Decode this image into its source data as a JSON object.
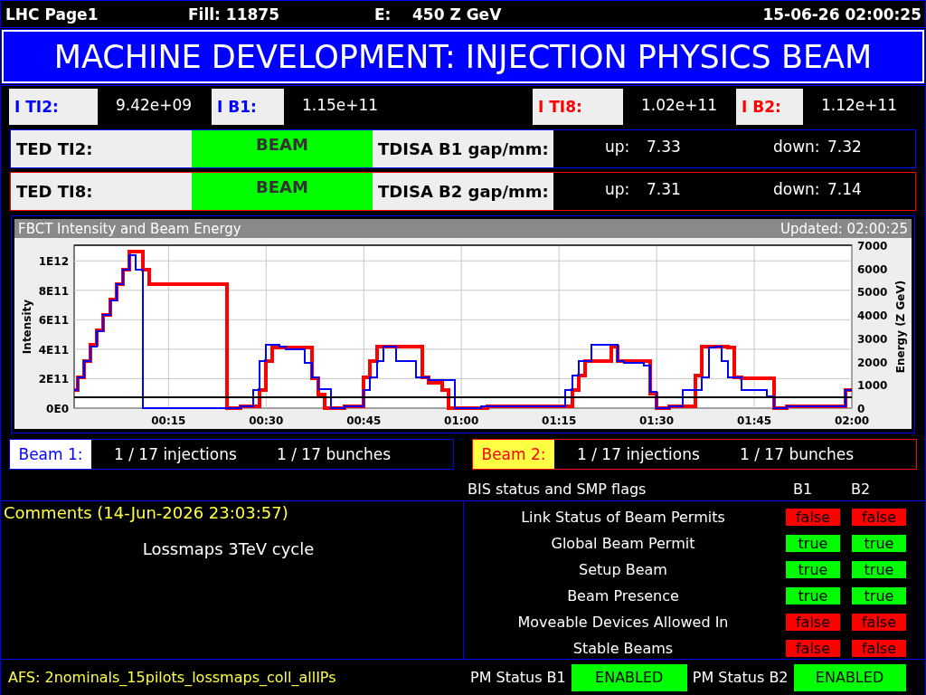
{
  "header": {
    "page": "LHC Page1",
    "fill": "Fill: 11875",
    "energy_label": "E:",
    "energy": "450 Z GeV",
    "timestamp": "15-06-26 02:00:25"
  },
  "mode": "MACHINE DEVELOPMENT: INJECTION PHYSICS BEAM",
  "intensities": [
    {
      "label": "I TI2:",
      "value": "9.42e+09",
      "color": "#0000ff"
    },
    {
      "label": "I B1:",
      "value": "1.15e+11",
      "color": "#0000ff"
    },
    {
      "label": "I TI8:",
      "value": "1.02e+11",
      "color": "#ff0000"
    },
    {
      "label": "I B2:",
      "value": "1.12e+11",
      "color": "#ff0000"
    }
  ],
  "ted_rows": [
    {
      "ted_label": "TED TI2:",
      "ted_state": "BEAM",
      "tdisa_label": "TDISA B1 gap/mm:",
      "up_label": "up:",
      "up": "7.33",
      "down_label": "down:",
      "down": "7.32",
      "color": "#0000ff"
    },
    {
      "ted_label": "TED TI8:",
      "ted_state": "BEAM",
      "tdisa_label": "TDISA B2 gap/mm:",
      "up_label": "up:",
      "up": "7.31",
      "down_label": "down:",
      "down": "7.14",
      "color": "#ff0000"
    }
  ],
  "chart": {
    "title": "FBCT Intensity and Beam Energy",
    "updated": "Updated: 02:00:25",
    "chart_data": {
      "type": "line",
      "ylabel": "Intensity",
      "y2label": "Energy (Z GeV)",
      "grid": true,
      "x": [
        0.5,
        1,
        1,
        2,
        2,
        3,
        3,
        4,
        4,
        5,
        5,
        6,
        6,
        7,
        7,
        8,
        8,
        9,
        9,
        10,
        10,
        11,
        11,
        12,
        12,
        13,
        13,
        14,
        14,
        15,
        15,
        16,
        16,
        17,
        17,
        18,
        18,
        19,
        19,
        20,
        20,
        21,
        21,
        22,
        22,
        23,
        23,
        24,
        24,
        25,
        25,
        26,
        26,
        27,
        27,
        28,
        28,
        29,
        29,
        30,
        30,
        31,
        31,
        32,
        32,
        33,
        33,
        34,
        34,
        35,
        35,
        36,
        36,
        37,
        37,
        38,
        38,
        39,
        39,
        40,
        40,
        41,
        41,
        42,
        42,
        43,
        43,
        44,
        44,
        45,
        45,
        46,
        46,
        47,
        47,
        48,
        48,
        49,
        49,
        50,
        50,
        51,
        51,
        52,
        52,
        53,
        53,
        54,
        54,
        55,
        55,
        56,
        56,
        57,
        57,
        58,
        58,
        59,
        59,
        60,
        60,
        61,
        61,
        62,
        62,
        63,
        63,
        64,
        64,
        65,
        65,
        66,
        66,
        67,
        67,
        68,
        68,
        69,
        69,
        70,
        70,
        71,
        71,
        72,
        72,
        73,
        73,
        74,
        74,
        75,
        75,
        76,
        76,
        77,
        77,
        78,
        78,
        79,
        79,
        80,
        80,
        81,
        81,
        82,
        82,
        83,
        83,
        84,
        84,
        85,
        85,
        86,
        86,
        87,
        87,
        88,
        88,
        89,
        89,
        90,
        90,
        91,
        91,
        92,
        92,
        93,
        93,
        94,
        94,
        95,
        95,
        96,
        96,
        97,
        97,
        98,
        98,
        99,
        99,
        100,
        100,
        101,
        101,
        102,
        102,
        103,
        103,
        104,
        104,
        105,
        105,
        106,
        106,
        107,
        107,
        108,
        108,
        109,
        109,
        110,
        110,
        111,
        111,
        112,
        112,
        113,
        113,
        114,
        114,
        115,
        115,
        116,
        116,
        117,
        117,
        118,
        118,
        119,
        119,
        120,
        120
      ],
      "xlim": [
        0.5,
        120
      ],
      "xticks": [
        {
          "value": 15,
          "label": "00:15"
        },
        {
          "value": 30,
          "label": "00:30"
        },
        {
          "value": 45,
          "label": "00:45"
        },
        {
          "value": 60,
          "label": "01:00"
        },
        {
          "value": 75,
          "label": "01:15"
        },
        {
          "value": 90,
          "label": "01:30"
        },
        {
          "value": 105,
          "label": "01:45"
        },
        {
          "value": 120,
          "label": "02:00"
        }
      ],
      "ylim": [
        0,
        1106000000000.0
      ],
      "yticks": [
        {
          "value": 0,
          "label": "0E0"
        },
        {
          "value": 200000000000.0,
          "label": "2E11"
        },
        {
          "value": 400000000000.0,
          "label": "4E11"
        },
        {
          "value": 600000000000.0,
          "label": "6E11"
        },
        {
          "value": 800000000000.0,
          "label": "8E11"
        },
        {
          "value": 1000000000000.0,
          "label": "1E12"
        }
      ],
      "y2lim": [
        0,
        7000
      ],
      "y2ticks": [
        0,
        1000,
        2000,
        3000,
        4000,
        5000,
        6000,
        7000
      ],
      "series": [
        {
          "color": "#0000ff",
          "values": [
            120000000000.0,
            120000000000.0,
            210000000000.0,
            210000000000.0,
            320000000000.0,
            320000000000.0,
            420000000000.0,
            420000000000.0,
            520000000000.0,
            520000000000.0,
            630000000000.0,
            630000000000.0,
            730000000000.0,
            730000000000.0,
            840000000000.0,
            840000000000.0,
            940000000000.0,
            940000000000.0,
            1040000000000.0,
            1040000000000.0,
            940000000000.0,
            940000000000.0,
            0,
            0,
            0,
            0,
            0,
            0,
            0,
            0,
            0,
            0,
            0,
            0,
            0,
            0,
            0,
            0,
            0,
            0,
            0,
            0,
            0,
            0,
            0,
            0,
            0,
            0,
            0,
            0,
            0,
            0,
            10000000000.0,
            10000000000.0,
            10000000000.0,
            10000000000.0,
            120000000000.0,
            120000000000.0,
            320000000000.0,
            320000000000.0,
            430000000000.0,
            430000000000.0,
            430000000000.0,
            430000000000.0,
            420000000000.0,
            420000000000.0,
            400000000000.0,
            400000000000.0,
            400000000000.0,
            400000000000.0,
            400000000000.0,
            400000000000.0,
            310000000000.0,
            310000000000.0,
            210000000000.0,
            210000000000.0,
            130000000000.0,
            130000000000.0,
            130000000000.0,
            130000000000.0,
            0,
            0,
            0,
            0,
            10000000000.0,
            10000000000.0,
            10000000000.0,
            10000000000.0,
            10000000000.0,
            10000000000.0,
            120000000000.0,
            120000000000.0,
            210000000000.0,
            210000000000.0,
            320000000000.0,
            320000000000.0,
            420000000000.0,
            420000000000.0,
            420000000000.0,
            420000000000.0,
            320000000000.0,
            320000000000.0,
            320000000000.0,
            320000000000.0,
            320000000000.0,
            320000000000.0,
            210000000000.0,
            210000000000.0,
            210000000000.0,
            210000000000.0,
            190000000000.0,
            190000000000.0,
            190000000000.0,
            190000000000.0,
            190000000000.0,
            190000000000.0,
            190000000000.0,
            190000000000.0,
            0,
            0,
            0,
            0,
            0,
            0,
            0,
            0,
            10000000000.0,
            10000000000.0,
            10000000000.0,
            10000000000.0,
            10000000000.0,
            10000000000.0,
            10000000000.0,
            10000000000.0,
            10000000000.0,
            10000000000.0,
            10000000000.0,
            10000000000.0,
            10000000000.0,
            10000000000.0,
            10000000000.0,
            10000000000.0,
            10000000000.0,
            10000000000.0,
            10000000000.0,
            10000000000.0,
            10000000000.0,
            10000000000.0,
            10000000000.0,
            10000000000.0,
            10000000000.0,
            10000000000.0,
            120000000000.0,
            120000000000.0,
            220000000000.0,
            220000000000.0,
            320000000000.0,
            320000000000.0,
            320000000000.0,
            320000000000.0,
            430000000000.0,
            430000000000.0,
            430000000000.0,
            430000000000.0,
            430000000000.0,
            430000000000.0,
            430000000000.0,
            430000000000.0,
            320000000000.0,
            320000000000.0,
            310000000000.0,
            310000000000.0,
            310000000000.0,
            310000000000.0,
            310000000000.0,
            310000000000.0,
            290000000000.0,
            290000000000.0,
            110000000000.0,
            110000000000.0,
            0,
            0,
            0,
            0,
            10000000000.0,
            10000000000.0,
            10000000000.0,
            10000000000.0,
            120000000000.0,
            120000000000.0,
            120000000000.0,
            120000000000.0,
            120000000000.0,
            120000000000.0,
            210000000000.0,
            210000000000.0,
            410000000000.0,
            410000000000.0,
            420000000000.0,
            420000000000.0,
            320000000000.0,
            320000000000.0,
            210000000000.0,
            210000000000.0,
            210000000000.0,
            210000000000.0,
            120000000000.0,
            120000000000.0,
            120000000000.0,
            120000000000.0,
            120000000000.0,
            120000000000.0,
            120000000000.0,
            120000000000.0,
            80000000000.0,
            80000000000.0,
            0,
            0,
            0,
            0,
            10000000000.0,
            10000000000.0,
            10000000000.0,
            10000000000.0,
            10000000000.0,
            10000000000.0,
            10000000000.0,
            10000000000.0,
            10000000000.0,
            10000000000.0,
            10000000000.0,
            10000000000.0,
            10000000000.0,
            10000000000.0,
            10000000000.0,
            10000000000.0,
            10000000000.0,
            10000000000.0,
            120000000000.0,
            120000000000.0,
            120000000000.0
          ]
        },
        {
          "color": "#ff0000",
          "values": [
            120000000000.0,
            120000000000.0,
            210000000000.0,
            210000000000.0,
            320000000000.0,
            320000000000.0,
            430000000000.0,
            430000000000.0,
            530000000000.0,
            530000000000.0,
            630000000000.0,
            630000000000.0,
            740000000000.0,
            740000000000.0,
            840000000000.0,
            840000000000.0,
            940000000000.0,
            940000000000.0,
            1060000000000.0,
            1060000000000.0,
            1060000000000.0,
            1060000000000.0,
            940000000000.0,
            940000000000.0,
            840000000000.0,
            840000000000.0,
            840000000000.0,
            840000000000.0,
            840000000000.0,
            840000000000.0,
            840000000000.0,
            840000000000.0,
            840000000000.0,
            840000000000.0,
            840000000000.0,
            840000000000.0,
            840000000000.0,
            840000000000.0,
            840000000000.0,
            840000000000.0,
            840000000000.0,
            840000000000.0,
            840000000000.0,
            840000000000.0,
            840000000000.0,
            840000000000.0,
            840000000000.0,
            840000000000.0,
            0,
            0,
            0,
            0,
            10000000000.0,
            10000000000.0,
            10000000000.0,
            10000000000.0,
            10000000000.0,
            10000000000.0,
            120000000000.0,
            120000000000.0,
            320000000000.0,
            320000000000.0,
            410000000000.0,
            410000000000.0,
            410000000000.0,
            410000000000.0,
            410000000000.0,
            410000000000.0,
            410000000000.0,
            410000000000.0,
            410000000000.0,
            410000000000.0,
            410000000000.0,
            410000000000.0,
            200000000000.0,
            200000000000.0,
            90000000000.0,
            90000000000.0,
            0,
            0,
            0,
            0,
            0,
            0,
            10000000000.0,
            10000000000.0,
            10000000000.0,
            10000000000.0,
            10000000000.0,
            10000000000.0,
            210000000000.0,
            210000000000.0,
            320000000000.0,
            320000000000.0,
            420000000000.0,
            420000000000.0,
            420000000000.0,
            420000000000.0,
            420000000000.0,
            420000000000.0,
            420000000000.0,
            420000000000.0,
            420000000000.0,
            420000000000.0,
            420000000000.0,
            420000000000.0,
            420000000000.0,
            420000000000.0,
            210000000000.0,
            210000000000.0,
            170000000000.0,
            170000000000.0,
            170000000000.0,
            170000000000.0,
            120000000000.0,
            120000000000.0,
            0,
            0,
            0,
            0,
            0,
            0,
            0,
            0,
            0,
            0,
            0,
            0,
            10000000000.0,
            10000000000.0,
            10000000000.0,
            10000000000.0,
            10000000000.0,
            10000000000.0,
            10000000000.0,
            10000000000.0,
            10000000000.0,
            10000000000.0,
            10000000000.0,
            10000000000.0,
            10000000000.0,
            10000000000.0,
            10000000000.0,
            10000000000.0,
            10000000000.0,
            10000000000.0,
            10000000000.0,
            10000000000.0,
            10000000000.0,
            10000000000.0,
            10000000000.0,
            10000000000.0,
            10000000000.0,
            10000000000.0,
            120000000000.0,
            120000000000.0,
            220000000000.0,
            220000000000.0,
            320000000000.0,
            320000000000.0,
            320000000000.0,
            320000000000.0,
            320000000000.0,
            320000000000.0,
            320000000000.0,
            320000000000.0,
            420000000000.0,
            420000000000.0,
            320000000000.0,
            320000000000.0,
            320000000000.0,
            320000000000.0,
            320000000000.0,
            320000000000.0,
            320000000000.0,
            320000000000.0,
            320000000000.0,
            320000000000.0,
            100000000000.0,
            100000000000.0,
            0,
            0,
            0,
            0,
            10000000000.0,
            10000000000.0,
            10000000000.0,
            10000000000.0,
            10000000000.0,
            10000000000.0,
            10000000000.0,
            10000000000.0,
            220000000000.0,
            220000000000.0,
            420000000000.0,
            420000000000.0,
            420000000000.0,
            420000000000.0,
            420000000000.0,
            420000000000.0,
            420000000000.0,
            420000000000.0,
            410000000000.0,
            410000000000.0,
            210000000000.0,
            210000000000.0,
            200000000000.0,
            200000000000.0,
            200000000000.0,
            200000000000.0,
            200000000000.0,
            200000000000.0,
            200000000000.0,
            200000000000.0,
            200000000000.0,
            200000000000.0,
            0,
            0,
            0,
            0,
            10000000000.0,
            10000000000.0,
            10000000000.0,
            10000000000.0,
            10000000000.0,
            10000000000.0,
            10000000000.0,
            10000000000.0,
            10000000000.0,
            10000000000.0,
            10000000000.0,
            10000000000.0,
            10000000000.0,
            10000000000.0,
            10000000000.0,
            10000000000.0,
            10000000000.0,
            10000000000.0,
            120000000000.0,
            120000000000.0,
            120000000000.0
          ]
        },
        {
          "color": "#000000",
          "axis": "y2",
          "values": [
            450,
            450,
            450,
            450,
            450,
            450,
            450,
            450,
            450,
            450,
            450,
            450,
            450,
            450,
            450,
            450,
            450,
            450,
            450,
            450,
            450,
            450,
            450,
            450,
            450,
            450,
            450,
            450,
            450,
            450,
            450,
            450,
            450,
            450,
            450,
            450,
            450,
            450,
            450,
            450,
            450,
            450,
            450,
            450,
            450,
            450,
            450,
            450,
            450,
            450,
            450,
            450,
            450,
            450,
            450,
            450,
            450,
            450,
            450,
            450,
            450,
            450,
            450,
            450,
            450,
            450,
            450,
            450,
            450,
            450,
            450,
            450,
            450,
            450,
            450,
            450,
            450,
            450,
            450,
            450,
            450,
            450,
            450,
            450,
            450,
            450,
            450,
            450,
            450,
            450,
            450,
            450,
            450,
            450,
            450,
            450,
            450,
            450,
            450,
            450,
            450,
            450,
            450,
            450,
            450,
            450,
            450,
            450,
            450,
            450,
            450,
            450,
            450,
            450,
            450,
            450,
            450,
            450,
            450,
            450,
            450,
            450,
            450,
            450,
            450,
            450,
            450,
            450,
            450,
            450,
            450,
            450,
            450,
            450,
            450,
            450,
            450,
            450,
            450,
            450,
            450,
            450,
            450,
            450,
            450,
            450,
            450,
            450,
            450,
            450,
            450,
            450,
            450,
            450,
            450,
            450,
            450,
            450,
            450,
            450,
            450,
            450,
            450,
            450,
            450,
            450,
            450,
            450,
            450,
            450,
            450,
            450,
            450,
            450,
            450,
            450,
            450,
            450,
            450,
            450,
            450,
            450,
            450,
            450,
            450,
            450,
            450,
            450,
            450,
            450,
            450,
            450,
            450,
            450,
            450,
            450,
            450,
            450,
            450,
            450,
            450,
            450,
            450,
            450,
            450,
            450,
            450,
            450,
            450,
            450,
            450,
            450,
            450,
            450,
            450,
            450,
            450,
            450,
            450,
            450,
            450,
            450,
            450,
            450,
            450,
            450,
            450,
            450,
            450,
            450,
            450,
            450,
            450,
            450,
            450,
            450,
            450,
            450,
            450,
            450,
            450
          ]
        }
      ]
    }
  },
  "beams": [
    {
      "label": "Beam 1:",
      "injections": "1 / 17 injections",
      "bunches": "1 / 17 bunches",
      "color": "#0000ff",
      "highlighted": false
    },
    {
      "label": "Beam 2:",
      "injections": "1 / 17 injections",
      "bunches": "1 / 17 bunches",
      "color": "#ff0000",
      "highlighted": true
    }
  ],
  "bis": {
    "title": "BIS status and SMP flags",
    "columns": [
      "B1",
      "B2"
    ],
    "flags": [
      {
        "label": "Link Status of Beam Permits",
        "values": [
          {
            "text": "false",
            "on": false
          },
          {
            "text": "false",
            "on": false
          }
        ]
      },
      {
        "label": "Global Beam Permit",
        "values": [
          {
            "text": "true",
            "on": true
          },
          {
            "text": "true",
            "on": true
          }
        ]
      },
      {
        "label": "Setup Beam",
        "values": [
          {
            "text": "true",
            "on": true
          },
          {
            "text": "true",
            "on": true
          }
        ]
      },
      {
        "label": "Beam Presence",
        "values": [
          {
            "text": "true",
            "on": true
          },
          {
            "text": "true",
            "on": true
          }
        ]
      },
      {
        "label": "Moveable Devices Allowed In",
        "values": [
          {
            "text": "false",
            "on": false
          },
          {
            "text": "false",
            "on": false
          }
        ]
      },
      {
        "label": "Stable Beams",
        "values": [
          {
            "text": "false",
            "on": false
          },
          {
            "text": "false",
            "on": false
          }
        ]
      }
    ]
  },
  "comments": {
    "title": "Comments (14-Jun-2026 23:03:57)",
    "text": "Lossmaps 3TeV cycle"
  },
  "footer": {
    "afs": "AFS: 2nominals_15pilots_lossmaps_coll_allIPs",
    "pm": [
      {
        "label": "PM Status B1",
        "status": "ENABLED",
        "on": true
      },
      {
        "label": "PM Status B2",
        "status": "ENABLED",
        "on": true
      }
    ]
  }
}
